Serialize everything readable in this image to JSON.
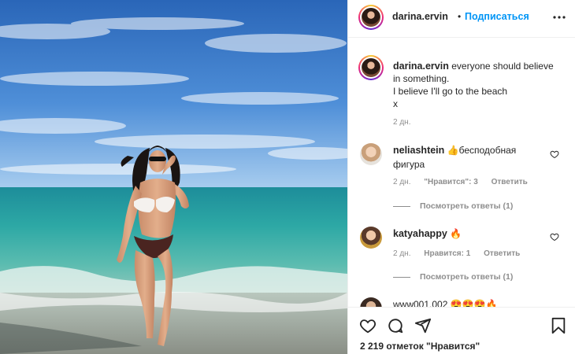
{
  "post": {
    "author": "darina.ervin",
    "dot": "•",
    "follow_label": "Подписаться"
  },
  "caption": {
    "author": "darina.ervin",
    "lines": [
      "everyone should believe",
      "in something.",
      "I believe I'll go to the beach",
      "x"
    ],
    "time": "2 дн."
  },
  "comments": [
    {
      "author": "neliashtein",
      "text": "👍бесподобная фигура",
      "time": "2 дн.",
      "likes": "\"Нравится\": 3",
      "reply": "Ответить",
      "view_replies": "Посмотреть ответы (1)"
    },
    {
      "author": "katyahappy",
      "text": "🔥",
      "time": "2 дн.",
      "likes": "Нравится: 1",
      "reply": "Ответить",
      "view_replies": "Посмотреть ответы (1)"
    },
    {
      "author": "www001.002",
      "text": "😍😍😍🔥"
    }
  ],
  "footer": {
    "likes_count": "2 219 отметок \"Нравится\""
  },
  "icons": {
    "more": "more-horizontal-icon",
    "like": "heart-icon",
    "comment": "comment-icon",
    "share": "share-icon",
    "save": "bookmark-icon"
  },
  "colors": {
    "accent": "#0095f6",
    "muted": "#8e8e8e",
    "text": "#262626"
  }
}
